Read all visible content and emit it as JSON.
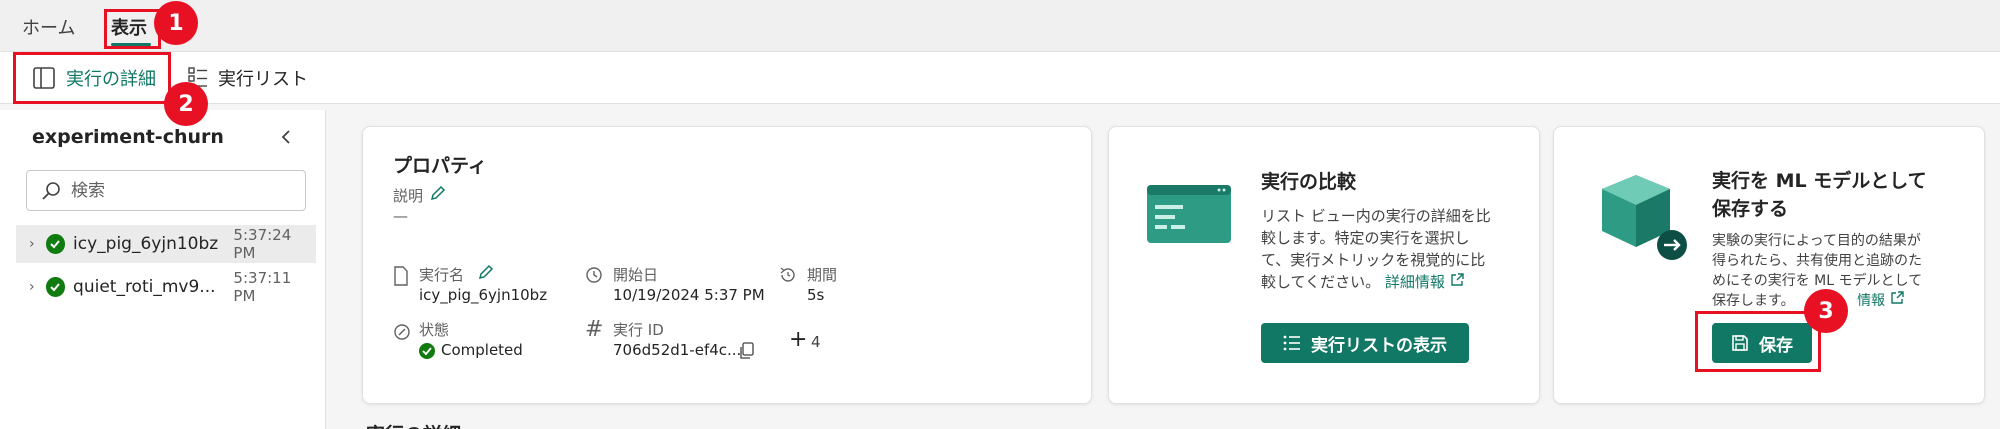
{
  "tabs": {
    "home": "ホーム",
    "view": "表示"
  },
  "ribbon": {
    "run_details": "実行の詳細",
    "run_list": "実行リスト"
  },
  "left_panel": {
    "experiment": "experiment-churn",
    "search_placeholder": "検索",
    "runs": [
      {
        "name": "icy_pig_6yjn10bz",
        "time": "5:37:24 PM",
        "status": "success"
      },
      {
        "name": "quiet_roti_mv9...",
        "time": "5:37:11 PM",
        "status": "success"
      }
    ]
  },
  "properties": {
    "title": "プロパティ",
    "description_label": "説明",
    "description_value": "—",
    "run_name_label": "実行名",
    "run_name_value": "icy_pig_6yjn10bz",
    "start_date_label": "開始日",
    "start_date_value": "10/19/2024 5:37 PM",
    "duration_label": "期間",
    "duration_value": "5s",
    "status_label": "状態",
    "status_value": "Completed",
    "run_id_label": "実行 ID",
    "run_id_value": "706d52d1-ef4c...",
    "more_count": "4"
  },
  "compare": {
    "title": "実行の比較",
    "desc_line1": "リスト ビュー内の実行の詳細を比",
    "desc_line2": "較します。特定の実行を選択し",
    "desc_line3": "て、実行メトリックを視覚的に比",
    "desc_line4": "較してください。",
    "link": "詳細情報",
    "button": "実行リストの表示"
  },
  "save_model": {
    "title_line1": "実行を ML モデルとして",
    "title_line2": "保存する",
    "desc_line1": "実験の実行によって目的の結果が",
    "desc_line2": "得られたら、共有使用と追跡のた",
    "desc_line3": "めにその実行を ML モデルとして",
    "desc_line4": "保存します。",
    "link": "情報",
    "button": "保存"
  },
  "annotations": [
    "1",
    "2",
    "3"
  ],
  "section_peek": "実行の詳細",
  "colors": {
    "accent": "#117865",
    "success": "#107c10",
    "annotation": "#e81123"
  }
}
